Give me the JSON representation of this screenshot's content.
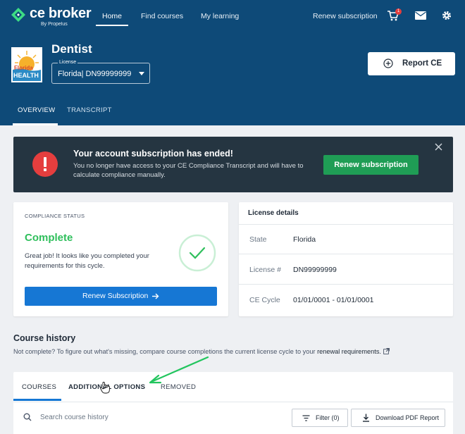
{
  "brand": {
    "name": "ce broker",
    "sub": "By Propelus"
  },
  "nav": {
    "home": "Home",
    "find_courses": "Find courses",
    "my_learning": "My learning",
    "renew_subscription": "Renew subscription",
    "cart_count": "1"
  },
  "profile": {
    "badge_top": "Florida",
    "badge_bottom": "HEALTH",
    "profession": "Dentist",
    "license_label": "License",
    "license_value": "Florida| DN99999999"
  },
  "actions": {
    "report_ce": "Report CE"
  },
  "tabs": {
    "overview": "OVERVIEW",
    "transcript": "TRANSCRIPT"
  },
  "alert": {
    "title": "Your account subscription has ended!",
    "body": "You no longer have access to your CE Compliance Transcript and will have to calculate compliance manually.",
    "button": "Renew subscription"
  },
  "compliance": {
    "label": "COMPLIANCE STATUS",
    "status": "Complete",
    "message": "Great job! It looks like you completed your requirements for this cycle.",
    "button": "Renew Subscription"
  },
  "license_details": {
    "title": "License details",
    "rows": [
      {
        "key": "State",
        "value": "Florida"
      },
      {
        "key": "License #",
        "value": "DN99999999"
      },
      {
        "key": "CE Cycle",
        "value": "01/01/0001 - 01/01/0001"
      }
    ]
  },
  "course_history": {
    "title": "Course history",
    "desc": "Not complete? To figure out what's missing, compare course completions the current license cycle to your",
    "link": "renewal requirements.",
    "tabs": {
      "courses": "COURSES",
      "additional": "ADDITIONAL OPTIONS",
      "removed": "REMOVED"
    },
    "search_placeholder": "Search course history",
    "filter": "Filter (0)",
    "download": "Download PDF Report"
  },
  "colors": {
    "header_bg": "#0e4a78",
    "alert_bg": "#253541",
    "success_green": "#2fbf5c",
    "button_green": "#1f9d55",
    "primary_blue": "#1677d4",
    "alert_red": "#e53e3e",
    "annotation_green": "#22c55e"
  }
}
